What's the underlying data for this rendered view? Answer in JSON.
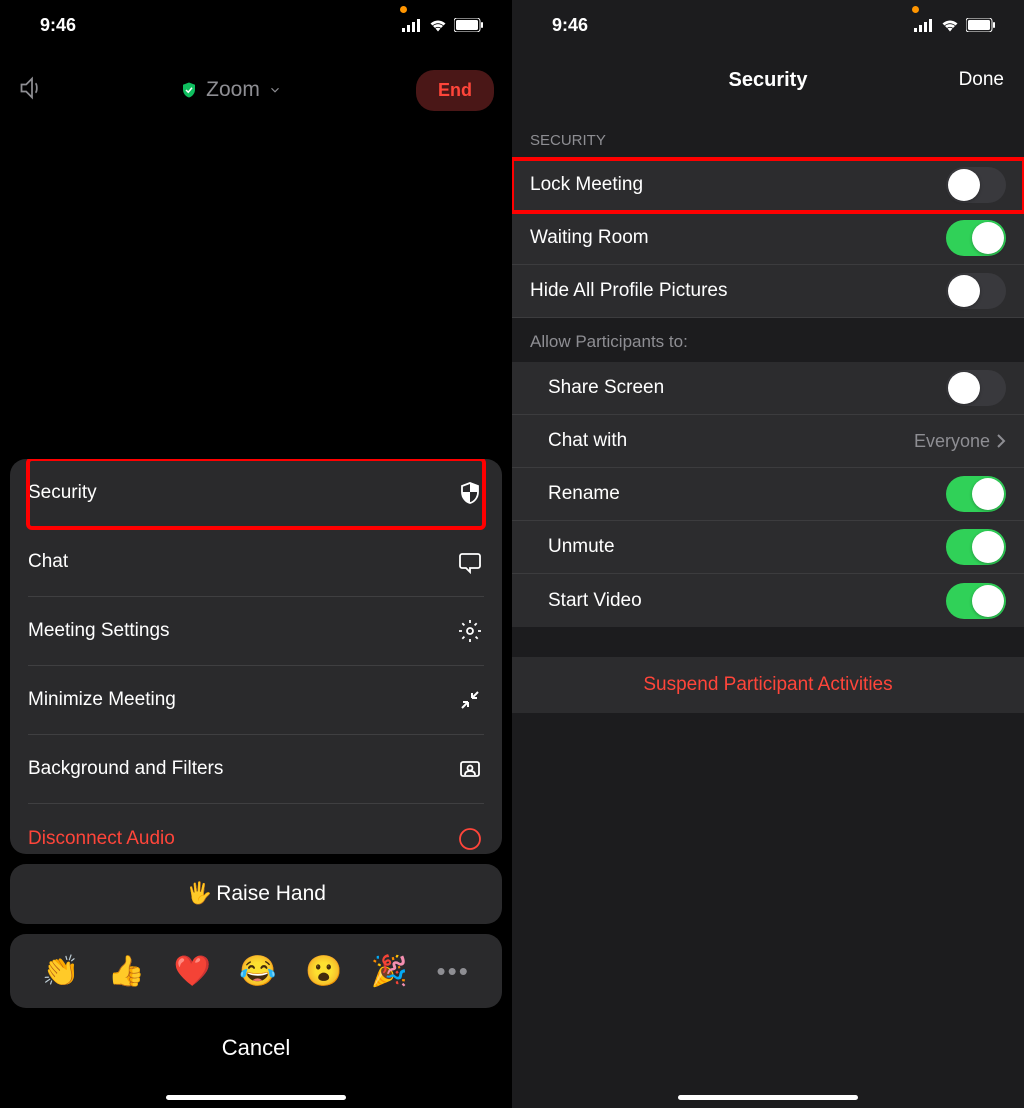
{
  "status": {
    "time": "9:46"
  },
  "left": {
    "app_name": "Zoom",
    "end_label": "End",
    "menu": {
      "security": "Security",
      "chat": "Chat",
      "settings": "Meeting Settings",
      "minimize": "Minimize Meeting",
      "background": "Background and Filters",
      "disconnect": "Disconnect Audio"
    },
    "raise_hand": "Raise Hand",
    "emojis": [
      "👏",
      "👍",
      "❤️",
      "😂",
      "😮",
      "🎉"
    ],
    "cancel": "Cancel"
  },
  "right": {
    "title": "Security",
    "done": "Done",
    "section_label": "SECURITY",
    "rows": {
      "lock": "Lock Meeting",
      "waiting": "Waiting Room",
      "hide_profiles": "Hide All Profile Pictures"
    },
    "allow_label": "Allow Participants to:",
    "permissions": {
      "share": "Share Screen",
      "chat_with": "Chat with",
      "chat_with_value": "Everyone",
      "rename": "Rename",
      "unmute": "Unmute",
      "start_video": "Start Video"
    },
    "suspend": "Suspend Participant Activities"
  }
}
